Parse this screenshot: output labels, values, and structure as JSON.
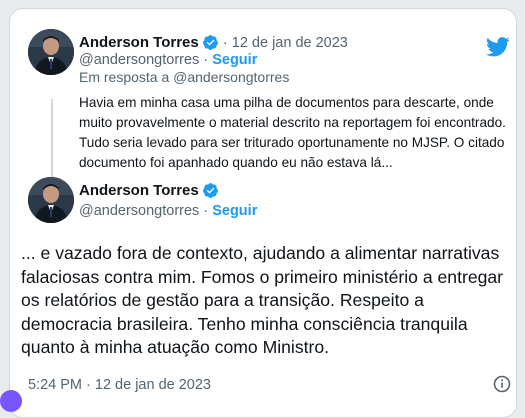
{
  "colors": {
    "accent": "#1d9bf0",
    "muted": "#536471",
    "text": "#0f1419",
    "border": "#cfd9de"
  },
  "icons": [
    "twitter-bird-icon",
    "verified-badge-icon",
    "info-icon"
  ],
  "quoted_tweet": {
    "author_name": "Anderson Torres",
    "handle": "@andersongtorres",
    "separator": "·",
    "follow_label": "Seguir",
    "date": "12 de jan de 2023",
    "reply_to": "Em resposta a @andersongtorres",
    "text": "Havia em minha casa uma pilha de documentos para descarte, onde muito provavelmente o material descrito na reportagem foi encontrado. Tudo seria levado para ser triturado oportunamente no MJSP. O citado documento foi apanhado quando eu não estava lá..."
  },
  "main_tweet": {
    "author_name": "Anderson Torres",
    "handle": "@andersongtorres",
    "separator": "·",
    "follow_label": "Seguir",
    "text": "... e vazado fora de contexto, ajudando a alimentar narrativas falaciosas contra mim. Fomos o primeiro ministério a entregar os relatórios de gestão para a transição. Respeito a democracia brasileira. Tenho minha consciência tranquila quanto à minha atuação como Ministro.",
    "timestamp": "5:24 PM · 12 de jan de 2023"
  }
}
